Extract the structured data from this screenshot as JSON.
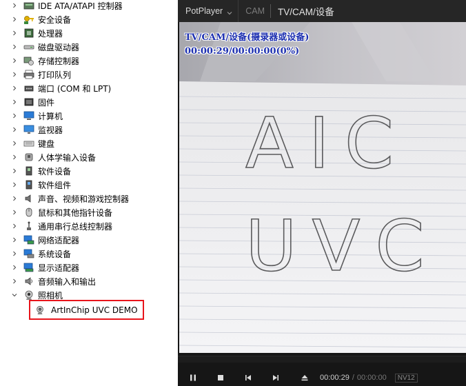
{
  "device_manager": {
    "categories": [
      {
        "label": "IDE ATA/ATAPI 控制器",
        "icon": "ide-controller-icon"
      },
      {
        "label": "安全设备",
        "icon": "security-key-icon"
      },
      {
        "label": "处理器",
        "icon": "processor-icon"
      },
      {
        "label": "磁盘驱动器",
        "icon": "disk-drive-icon"
      },
      {
        "label": "存储控制器",
        "icon": "storage-controller-icon"
      },
      {
        "label": "打印队列",
        "icon": "printer-icon"
      },
      {
        "label": "端口 (COM 和 LPT)",
        "icon": "port-icon"
      },
      {
        "label": "固件",
        "icon": "firmware-icon"
      },
      {
        "label": "计算机",
        "icon": "computer-icon"
      },
      {
        "label": "监视器",
        "icon": "monitor-icon"
      },
      {
        "label": "键盘",
        "icon": "keyboard-icon"
      },
      {
        "label": "人体学输入设备",
        "icon": "hid-icon"
      },
      {
        "label": "软件设备",
        "icon": "software-device-icon"
      },
      {
        "label": "软件组件",
        "icon": "software-component-icon"
      },
      {
        "label": "声音、视频和游戏控制器",
        "icon": "speaker-icon"
      },
      {
        "label": "鼠标和其他指针设备",
        "icon": "mouse-icon"
      },
      {
        "label": "通用串行总线控制器",
        "icon": "usb-icon"
      },
      {
        "label": "网络适配器",
        "icon": "network-adapter-icon"
      },
      {
        "label": "系统设备",
        "icon": "system-device-icon"
      },
      {
        "label": "显示适配器",
        "icon": "display-adapter-icon"
      },
      {
        "label": "音频输入和输出",
        "icon": "audio-io-icon"
      },
      {
        "label": "照相机",
        "icon": "camera-icon",
        "expanded": true
      }
    ],
    "camera_child": {
      "label": "ArtInChip UVC DEMO",
      "icon": "webcam-icon",
      "highlight_color": "#e8141b"
    }
  },
  "player": {
    "app_name": "PotPlayer",
    "tab_cam": "CAM",
    "tab_title": "TV/CAM/设备",
    "osd_title": "TV/CAM/设备(摄录器或设备)",
    "osd_time": "00:00:29/00:00:00(0%)",
    "osd_color": "#1c2fb0",
    "video_text_row1": "AIC",
    "video_text_row2": "UVC",
    "controls": {
      "time_current": "00:00:29",
      "time_separator": "/",
      "time_total": "00:00:00",
      "format": "NV12"
    }
  }
}
